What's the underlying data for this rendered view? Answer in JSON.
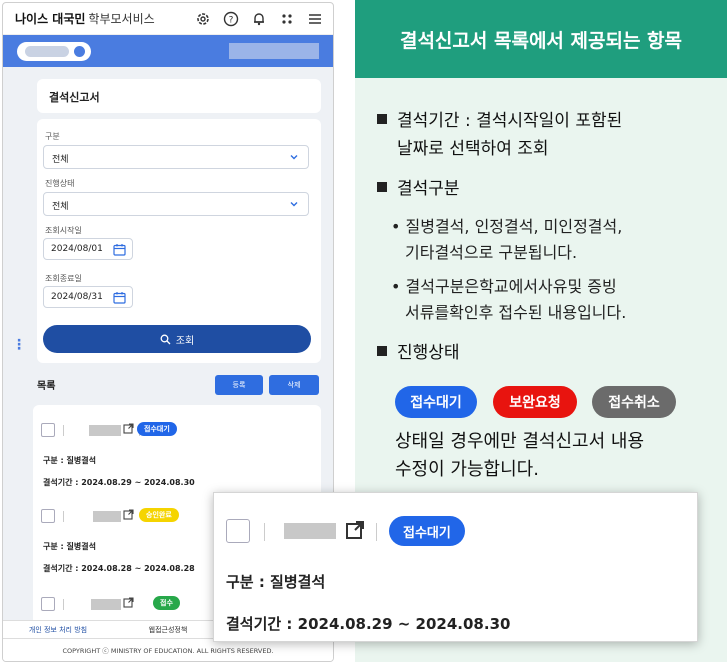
{
  "app": {
    "brand": "나이스 대국민",
    "brand_sub": "학부모서비스"
  },
  "page_title": "결석신고서",
  "form": {
    "category_label": "구분",
    "category_value": "전체",
    "status_label": "진행상태",
    "status_value": "전체",
    "start_label": "조회시작일",
    "start_value": "2024/08/01",
    "end_label": "조회종료일",
    "end_value": "2024/08/31",
    "search_label": "조회"
  },
  "list": {
    "title": "목록",
    "register_label": "등록",
    "delete_label": "삭제",
    "rows": [
      {
        "badge": "접수대기",
        "category": "구분 : 질병결석",
        "period": "결석기간 : 2024.08.29 ~ 2024.08.30"
      },
      {
        "badge": "승인완료",
        "category": "구분 : 질병결석",
        "period": "결석기간 : 2024.08.28 ~ 2024.08.28"
      },
      {
        "badge": "접수"
      }
    ]
  },
  "footer": {
    "privacy": "개인 정보 처리 방침",
    "accessibility": "웹접근성정책",
    "copyright": "COPYRIGHT ⓒ MINISTRY OF EDUCATION. ALL RIGHTS RESERVED."
  },
  "panel": {
    "heading": "결석신고서 목록에서 제공되는 항목",
    "b1_line1": "결석기간 : 결석시작일이 포함된",
    "b1_line2": "날짜로 선택하여 조회",
    "b2": "결석구분",
    "b2_sub1_line1": "• 질병결석, 인정결석, 미인정결석,",
    "b2_sub1_line2": "기타결석으로 구분됩니다.",
    "b2_sub2_line1": "• 결석구분은학교에서사유및 증빙",
    "b2_sub2_line2": "서류를확인후 접수된 내용입니다.",
    "b3": "진행상태",
    "badges": [
      "접수대기",
      "보완요청",
      "접수취소"
    ],
    "note_line1": "상태일 경우에만 결석신고서 내용",
    "note_line2": "수정이 가능합니다."
  },
  "zoom": {
    "badge": "접수대기",
    "category": "구분 : 질병결석",
    "period": "결석기간 : 2024.08.29 ~ 2024.08.30"
  },
  "colors": {
    "header_green": "#1f9e7e",
    "panel_bg": "#eaf5ef",
    "blue": "#2166e8",
    "red": "#e8140f",
    "gray": "#6b6b6b",
    "yellow": "#f5d400",
    "green": "#27a84a",
    "navy": "#1f4ea3"
  }
}
